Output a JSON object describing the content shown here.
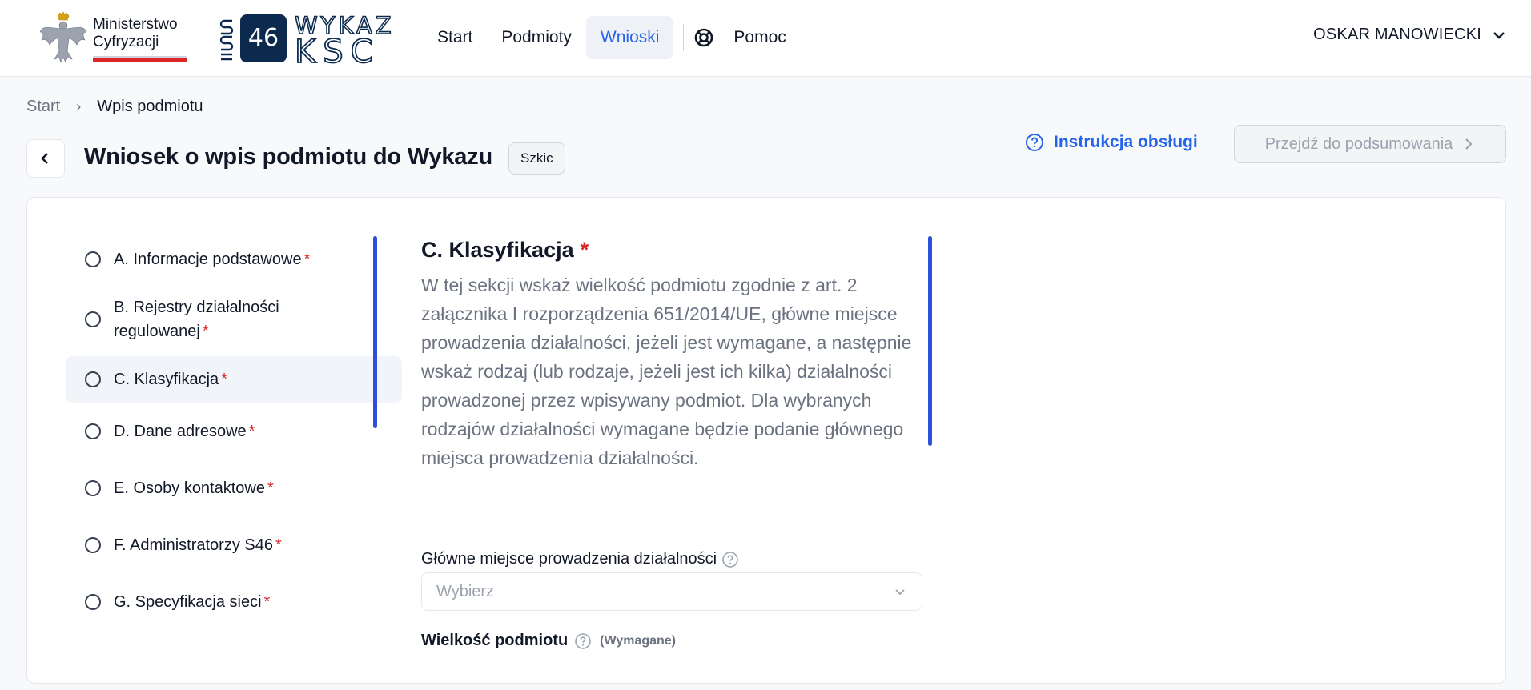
{
  "header": {
    "ministry_name_line1": "Ministerstwo",
    "ministry_name_line2": "Cyfryzacji",
    "ksc_box_text": "46",
    "ksc_word_top": "WYKAZ",
    "ksc_word_bottom": "KSC",
    "nav": [
      {
        "label": "Start"
      },
      {
        "label": "Podmioty"
      },
      {
        "label": "Wnioski"
      }
    ],
    "help_label": "Pomoc",
    "user_name": "OSKAR MANOWIECKI"
  },
  "breadcrumb": {
    "start": "Start",
    "current": "Wpis podmiotu"
  },
  "page": {
    "title": "Wniosek o wpis podmiotu do Wykazu",
    "status_badge": "Szkic",
    "manual_link": "Instrukcja obsługi",
    "summary_button": "Przejdź do podsumowania"
  },
  "steps": [
    {
      "label": "A. Informacje podstawowe",
      "required": "*"
    },
    {
      "label": "B. Rejestry działalności regulowanej",
      "required": "*"
    },
    {
      "label": "C. Klasyfikacja",
      "required": "*"
    },
    {
      "label": "D. Dane adresowe",
      "required": "*"
    },
    {
      "label": "E. Osoby kontaktowe",
      "required": "*"
    },
    {
      "label": "F. Administratorzy S46",
      "required": "*"
    },
    {
      "label": "G. Specyfikacja sieci",
      "required": "*"
    }
  ],
  "section": {
    "title": "C. Klasyfikacja",
    "required": "*",
    "description": "W tej sekcji wskaż wielkość podmiotu zgodnie z art. 2 załącznika I rozporządzenia 651/2014/UE, główne miejsce prowadzenia działalności, jeżeli jest wymagane, a następnie wskaż rodzaj (lub rodzaje, jeżeli jest ich kilka) działalności prowadzonej przez wpisywany podmiot. Dla wybranych rodzajów działalności wymagane będzie podanie głównego miejsca prowadzenia działalności."
  },
  "fields": {
    "main_place_label": "Główne miejsce prowadzenia działalności",
    "main_place_placeholder": "Wybierz",
    "size_label": "Wielkość podmiotu",
    "size_required_text": "(Wymagane)"
  },
  "colors": {
    "accent": "#2563eb",
    "active_nav_bg": "#eef2f7",
    "required": "#dc2626",
    "progress_bar": "#2f4fd8",
    "ksc_box": "#0b2a4e"
  },
  "icons": {
    "back": "chevron-left-icon",
    "help": "lifebuoy-icon",
    "manual": "question-circle-icon",
    "summary": "chevron-right-icon",
    "user_menu": "chevron-down-icon",
    "select": "chevron-down-icon",
    "tooltip": "question-circle-icon"
  }
}
